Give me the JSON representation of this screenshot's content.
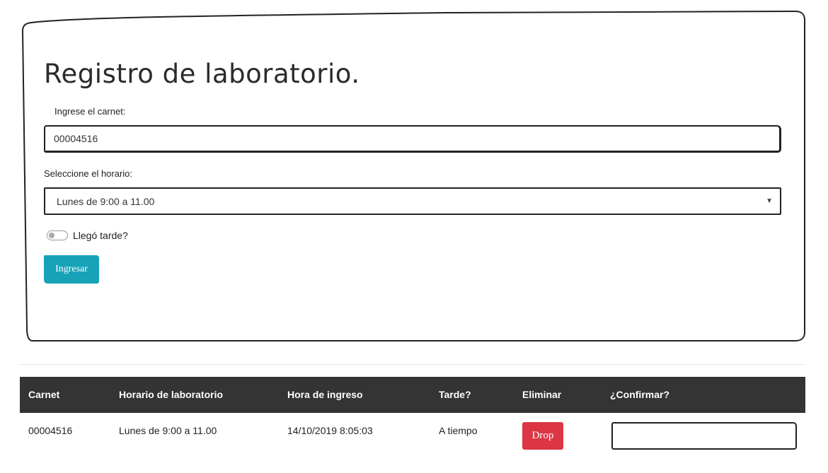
{
  "form": {
    "title": "Registro de laboratorio.",
    "carnet_label": "Ingrese el carnet:",
    "carnet_value": "00004516",
    "horario_label": "Seleccione el horario:",
    "horario_selected": "Lunes de 9:00 a 11.00",
    "select_arrow": "▼",
    "late_label": "Llegó tarde?",
    "late_checked": false,
    "submit_label": "Ingresar"
  },
  "table": {
    "headers": [
      "Carnet",
      "Horario de laboratorio",
      "Hora de ingreso",
      "Tarde?",
      "Eliminar",
      "¿Confirmar?"
    ],
    "rows": [
      {
        "carnet": "00004516",
        "horario": "Lunes de 9:00 a 11.00",
        "hora_ingreso": "14/10/2019 8:05:03",
        "tarde": "A tiempo",
        "eliminar_label": "Drop",
        "confirmar_value": ""
      }
    ]
  },
  "colors": {
    "primary": "#17a2b8",
    "danger": "#dc3545",
    "table_header_bg": "#343434"
  }
}
